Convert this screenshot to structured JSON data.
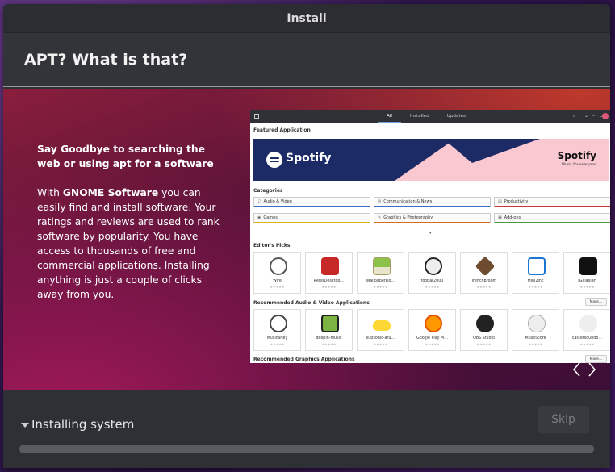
{
  "window": {
    "title": "Install"
  },
  "header": {
    "title": "APT? What is that?"
  },
  "slide": {
    "heading": "Say Goodbye to searching the web or using apt for a software",
    "body_prefix": "With ",
    "body_bold": "GNOME Software",
    "body_suffix": " you can easily find and install software. Your ratings and reviews are used to rank software by popularity. You have access to thousands of free and commercial applications. Installing anything is just a couple of clicks away from you.",
    "prev_icon": "chevron-left-icon",
    "next_icon": "chevron-right-icon"
  },
  "screenshot": {
    "tabs": [
      "All",
      "Installed",
      "Updates"
    ],
    "featured_label": "Featured Application",
    "banner_left": "Spotify",
    "banner_right": "Spotify",
    "banner_sub": "Music for everyone",
    "categories_label": "Categories",
    "categories": [
      {
        "label": "Audio & Video",
        "icon": "♫"
      },
      {
        "label": "Communication & News",
        "icon": "✉"
      },
      {
        "label": "Productivity",
        "icon": "▤"
      },
      {
        "label": "Games",
        "icon": "◉"
      },
      {
        "label": "Graphics & Photography",
        "icon": "✎"
      },
      {
        "label": "Add-ons",
        "icon": "▣"
      }
    ],
    "picks_label": "Editor's Picks",
    "picks": [
      {
        "name": "Wire",
        "color": "#ffffff"
      },
      {
        "name": "RedisDesktop…",
        "color": "#c62828"
      },
      {
        "name": "WallpaperDo…",
        "color": "#8bc34a"
      },
      {
        "name": "foobar2000",
        "color": "#eeeeee"
      },
      {
        "name": "TrenchBroom",
        "color": "#6d4c2f"
      },
      {
        "name": "Mini2Inc",
        "color": "#1976d2"
      },
      {
        "name": "JGalaxian",
        "color": "#111111"
      }
    ],
    "audio_label": "Recommended Audio & Video Applications",
    "more_label": "More…",
    "audio": [
      {
        "name": "Musicarley",
        "color": "#ffffff"
      },
      {
        "name": "deepin-music",
        "color": "#7cb342"
      },
      {
        "name": "subsonic-aru…",
        "color": "#fdd835"
      },
      {
        "name": "Google Play M…",
        "color": "#ff9800"
      },
      {
        "name": "OBS Studio",
        "color": "#222222"
      },
      {
        "name": "MuseScore",
        "color": "#eeeeee"
      },
      {
        "name": "castersoundb…",
        "color": "#eeeeee"
      }
    ],
    "graphics_label": "Recommended Graphics Applications",
    "stars": "★★★★★"
  },
  "footer": {
    "status": "Installing system",
    "skip_label": "Skip",
    "progress": 0
  }
}
